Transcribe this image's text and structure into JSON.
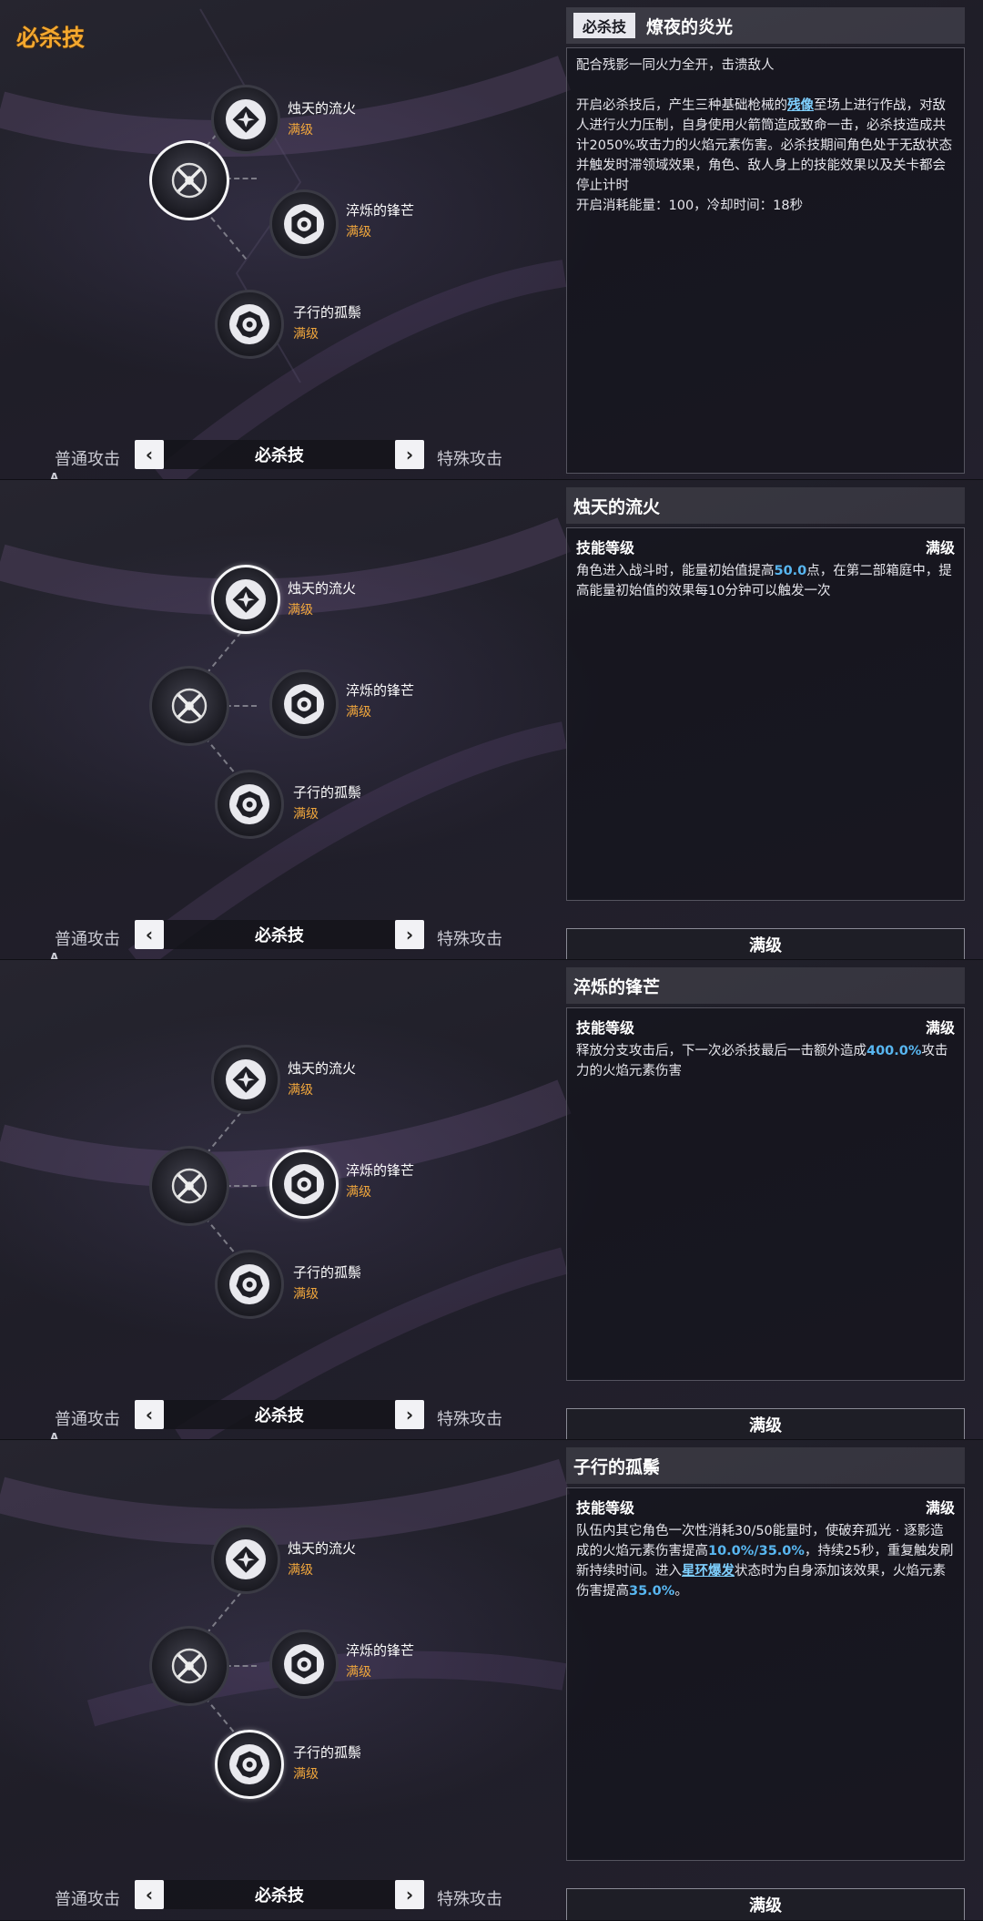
{
  "section_title": "必杀技",
  "corner_a": "A",
  "nodes": {
    "n1": {
      "name": "烛天的流火",
      "level": "满级"
    },
    "n2": {
      "name": "淬烁的锋芒",
      "level": "满级"
    },
    "n3": {
      "name": "子行的孤鬃",
      "level": "满级"
    }
  },
  "nav": {
    "left": "普通攻击",
    "center": "必杀技",
    "right": "特殊攻击",
    "prev": "‹",
    "next": "›"
  },
  "panels": [
    {
      "tag": "必杀技",
      "title": "燎夜的炎光",
      "intro": "配合残影一同火力全开，击溃敌人",
      "desc_a": "开启必杀技后，产生三种基础枪械的",
      "desc_link": "残像",
      "desc_b": "至场上进行作战，对敌人进行火力压制，自身使用火箭筒造成致命一击，必杀技造成共计2050%攻击力的火焰元素伤害。必杀技期间角色处于无敌状态并触发时滞领域效果，角色、敌人身上的技能效果以及关卡都会停止计时\n开启消耗能量：100，冷却时间：18秒"
    },
    {
      "title": "烛天的流火",
      "level_label": "技能等级",
      "level_value": "满级",
      "desc_a": "角色进入战斗时，能量初始值提高",
      "desc_hl": "50.0",
      "desc_b": "点，在第二部箱庭中，提高能量初始值的效果每10分钟可以触发一次",
      "button": "满级"
    },
    {
      "title": "淬烁的锋芒",
      "level_label": "技能等级",
      "level_value": "满级",
      "desc_a": "释放分支攻击后，下一次必杀技最后一击额外造成",
      "desc_hl": "400.0%",
      "desc_b": "攻击力的火焰元素伤害",
      "button": "满级"
    },
    {
      "title": "子行的孤鬃",
      "level_label": "技能等级",
      "level_value": "满级",
      "desc_a": "队伍内其它角色一次性消耗30/50能量时，使破弃孤光 · 逐影造成的火焰元素伤害提高",
      "desc_hl1": "10.0%/35.0%",
      "desc_b": "，持续25秒，重复触发刷新持续时间。进入",
      "desc_link": "星环爆发",
      "desc_c": "状态时为自身添加该效果，火焰元素伤害提高",
      "desc_hl2": "35.0%",
      "desc_d": "。",
      "button": "满级"
    }
  ],
  "colors": {
    "accent_orange": "#f4a82e",
    "level_orange": "#f0a63c",
    "highlight_blue": "#58b6f0"
  },
  "icons": [
    "diamond-star-icon",
    "shield-gear-icon",
    "flower-gear-icon",
    "crossed-weapons-icon"
  ]
}
